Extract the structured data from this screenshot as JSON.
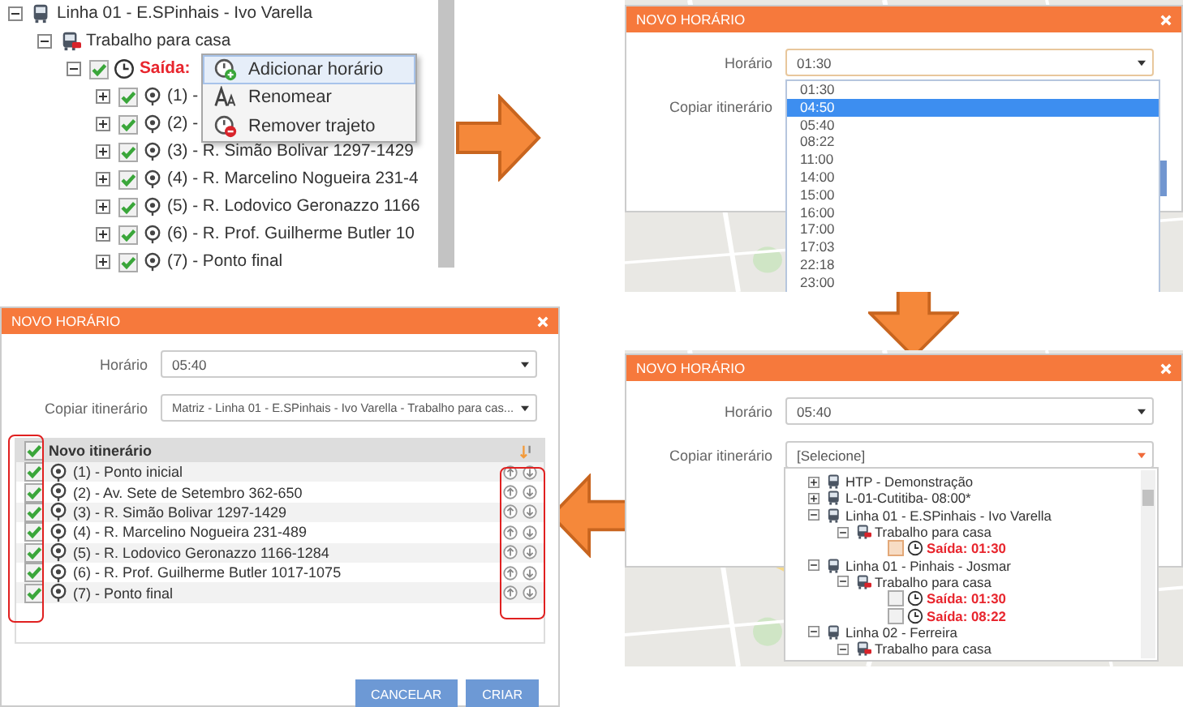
{
  "tree_panel": {
    "nodes": [
      {
        "label": "Linha 01 - E.SPinhais - Ivo Varella",
        "kind": "line",
        "expanded": true,
        "children": [
          {
            "label": "Trabalho para casa",
            "kind": "route",
            "expanded": true,
            "children": [
              {
                "label": "Saída:",
                "kind": "departure",
                "checked": true,
                "expanded": true,
                "children": [
                  {
                    "label": "(1) -",
                    "kind": "stop",
                    "checked": true,
                    "expanded": false
                  },
                  {
                    "label": "(2) -",
                    "kind": "stop",
                    "checked": true,
                    "expanded": false
                  },
                  {
                    "label": "(3) - R. Simão Bolivar 1297-1429",
                    "kind": "stop",
                    "checked": true,
                    "expanded": false
                  },
                  {
                    "label": "(4) - R. Marcelino Nogueira 231-4",
                    "kind": "stop",
                    "checked": true,
                    "expanded": false
                  },
                  {
                    "label": "(5) - R. Lodovico Geronazzo 1166",
                    "kind": "stop",
                    "checked": true,
                    "expanded": false
                  },
                  {
                    "label": "(6) - R. Prof. Guilherme Butler 10",
                    "kind": "stop",
                    "checked": true,
                    "expanded": false
                  },
                  {
                    "label": "(7) - Ponto final",
                    "kind": "stop",
                    "checked": true,
                    "expanded": false
                  }
                ]
              }
            ]
          }
        ]
      }
    ],
    "context_menu": [
      {
        "label": "Adicionar horário",
        "kind": "add",
        "selected": true
      },
      {
        "label": "Renomear",
        "kind": "rename",
        "selected": false
      },
      {
        "label": "Remover trajeto",
        "kind": "remove",
        "selected": false
      }
    ]
  },
  "dialogs": [
    {
      "kind": "time-list",
      "title": "NOVO HORÁRIO",
      "time_label": "Horário",
      "time_value": "01:30",
      "copy_label": "Copiar itinerário",
      "options": [
        {
          "label": "01:30",
          "selected": false
        },
        {
          "label": "04:50",
          "selected": true
        },
        {
          "label": "05:40",
          "selected": false
        },
        {
          "label": "08:22",
          "selected": false
        },
        {
          "label": "11:00",
          "selected": false
        },
        {
          "label": "14:00",
          "selected": false
        },
        {
          "label": "15:00",
          "selected": false
        },
        {
          "label": "16:00",
          "selected": false
        },
        {
          "label": "17:00",
          "selected": false
        },
        {
          "label": "17:03",
          "selected": false
        },
        {
          "label": "22:18",
          "selected": false
        },
        {
          "label": "23:00",
          "selected": false
        }
      ]
    },
    {
      "kind": "itinerary",
      "title": "NOVO HORÁRIO",
      "time_label": "Horário",
      "time_value": "05:40",
      "copy_label": "Copiar itinerário",
      "copy_value": "Matriz - Linha 01 - E.SPinhais - Ivo Varella - Trabalho para cas...",
      "table": {
        "header": "Novo itinerário",
        "checked": true,
        "rows": [
          {
            "label": "(1) - Ponto inicial",
            "checked": true
          },
          {
            "label": "(2) - Av. Sete de Setembro 362-650",
            "checked": true
          },
          {
            "label": "(3) - R. Simão Bolivar 1297-1429",
            "checked": true
          },
          {
            "label": "(4) - R. Marcelino Nogueira 231-489",
            "checked": true
          },
          {
            "label": "(5) - R. Lodovico Geronazzo 1166-1284",
            "checked": true
          },
          {
            "label": "(6) - R. Prof. Guilherme Butler 1017-1075",
            "checked": true
          },
          {
            "label": "(7) - Ponto final",
            "checked": true
          }
        ]
      },
      "buttons": [
        "CANCELAR",
        "CRIAR"
      ]
    },
    {
      "kind": "tree-select",
      "title": "NOVO HORÁRIO",
      "time_label": "Horário",
      "time_value": "05:40",
      "copy_label": "Copiar itinerário",
      "copy_value": "[Selecione]",
      "nodes": [
        {
          "label": "HTP - Demonstração",
          "kind": "line",
          "expanded": false
        },
        {
          "label": "L-01-Cutitiba- 08:00*",
          "kind": "line",
          "expanded": false
        },
        {
          "label": "Linha 01 - E.SPinhais - Ivo Varella",
          "kind": "line",
          "expanded": true,
          "children": [
            {
              "label": "Trabalho para casa",
              "kind": "route",
              "expanded": true,
              "children": [
                {
                  "label": "Saída: 01:30",
                  "kind": "departure",
                  "checked": false,
                  "selected": true
                }
              ]
            }
          ]
        },
        {
          "label": "Linha 01 - Pinhais - Josmar",
          "kind": "line",
          "expanded": true,
          "children": [
            {
              "label": "Trabalho para casa",
              "kind": "route",
              "expanded": true,
              "children": [
                {
                  "label": "Saída: 01:30",
                  "kind": "departure",
                  "checked": false,
                  "selected": false
                },
                {
                  "label": "Saída: 08:22",
                  "kind": "departure",
                  "checked": false,
                  "selected": false
                }
              ]
            }
          ]
        },
        {
          "label": "Linha 02 - Ferreira",
          "kind": "line",
          "expanded": true,
          "children": [
            {
              "label": "Trabalho para casa",
              "kind": "route",
              "expanded": true
            }
          ]
        }
      ]
    }
  ]
}
